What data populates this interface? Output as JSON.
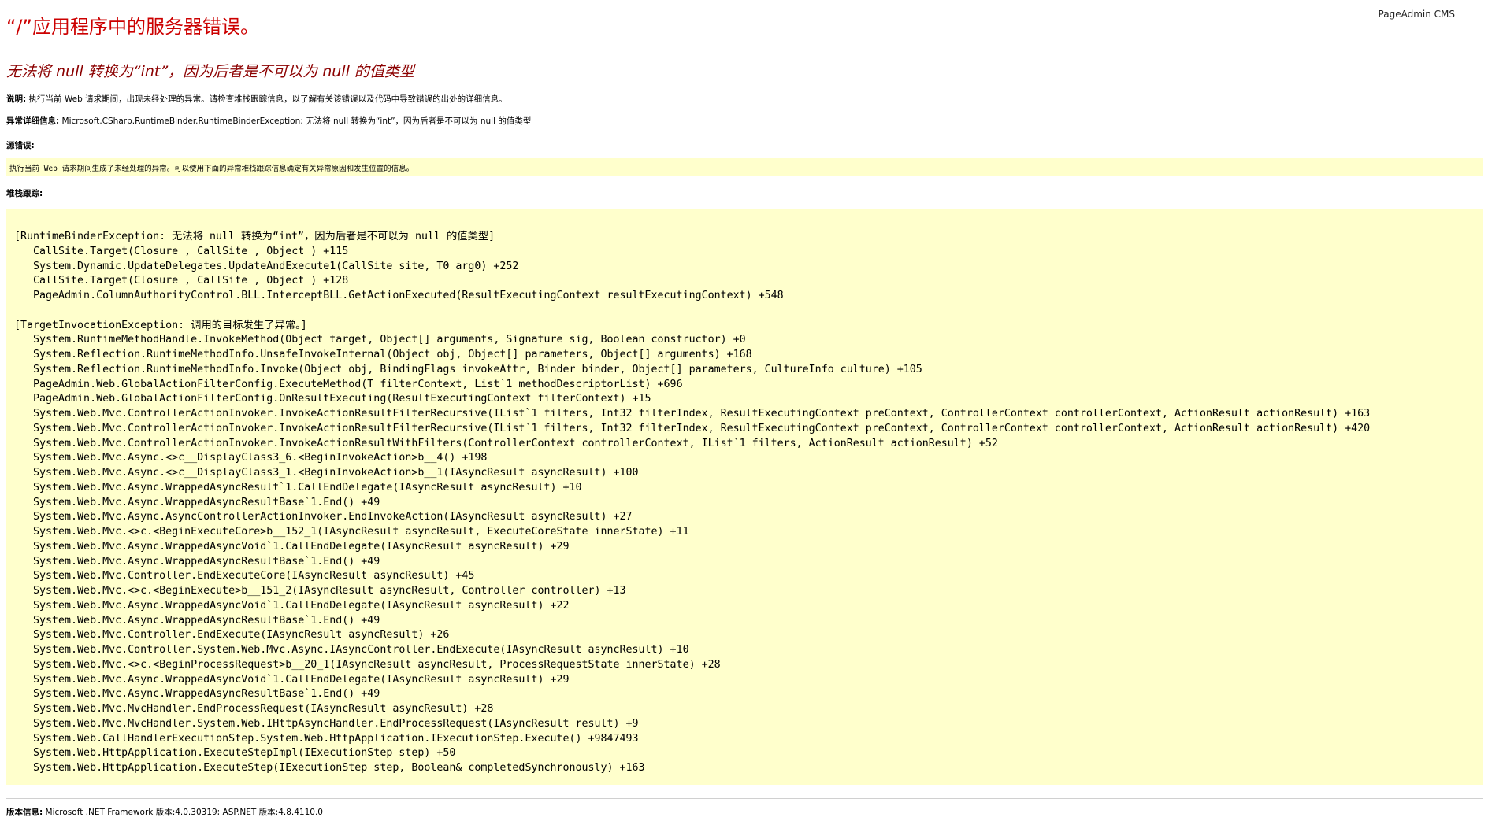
{
  "brand": "PageAdmin CMS",
  "title": "“/”应用程序中的服务器错误。",
  "subtitle": "无法将 null 转换为“int”，因为后者是不可以为 null 的值类型",
  "description": {
    "label": "说明:",
    "text": " 执行当前 Web 请求期间，出现未经处理的异常。请检查堆栈跟踪信息，以了解有关该错误以及代码中导致错误的出处的详细信息。"
  },
  "exception_details": {
    "label": "异常详细信息:",
    "text": " Microsoft.CSharp.RuntimeBinder.RuntimeBinderException: 无法将 null 转换为“int”，因为后者是不可以为 null 的值类型"
  },
  "source_error": {
    "label": "源错误:",
    "text": "执行当前 Web 请求期间生成了未经处理的异常。可以使用下面的异常堆栈跟踪信息确定有关异常原因和发生位置的信息。"
  },
  "stack_trace": {
    "label": "堆栈跟踪:",
    "text": "[RuntimeBinderException: 无法将 null 转换为“int”，因为后者是不可以为 null 的值类型]\n   CallSite.Target(Closure , CallSite , Object ) +115\n   System.Dynamic.UpdateDelegates.UpdateAndExecute1(CallSite site, T0 arg0) +252\n   CallSite.Target(Closure , CallSite , Object ) +128\n   PageAdmin.ColumnAuthorityControl.BLL.InterceptBLL.GetActionExecuted(ResultExecutingContext resultExecutingContext) +548\n\n[TargetInvocationException: 调用的目标发生了异常。]\n   System.RuntimeMethodHandle.InvokeMethod(Object target, Object[] arguments, Signature sig, Boolean constructor) +0\n   System.Reflection.RuntimeMethodInfo.UnsafeInvokeInternal(Object obj, Object[] parameters, Object[] arguments) +168\n   System.Reflection.RuntimeMethodInfo.Invoke(Object obj, BindingFlags invokeAttr, Binder binder, Object[] parameters, CultureInfo culture) +105\n   PageAdmin.Web.GlobalActionFilterConfig.ExecuteMethod(T filterContext, List`1 methodDescriptorList) +696\n   PageAdmin.Web.GlobalActionFilterConfig.OnResultExecuting(ResultExecutingContext filterContext) +15\n   System.Web.Mvc.ControllerActionInvoker.InvokeActionResultFilterRecursive(IList`1 filters, Int32 filterIndex, ResultExecutingContext preContext, ControllerContext controllerContext, ActionResult actionResult) +163\n   System.Web.Mvc.ControllerActionInvoker.InvokeActionResultFilterRecursive(IList`1 filters, Int32 filterIndex, ResultExecutingContext preContext, ControllerContext controllerContext, ActionResult actionResult) +420\n   System.Web.Mvc.ControllerActionInvoker.InvokeActionResultWithFilters(ControllerContext controllerContext, IList`1 filters, ActionResult actionResult) +52\n   System.Web.Mvc.Async.<>c__DisplayClass3_6.<BeginInvokeAction>b__4() +198\n   System.Web.Mvc.Async.<>c__DisplayClass3_1.<BeginInvokeAction>b__1(IAsyncResult asyncResult) +100\n   System.Web.Mvc.Async.WrappedAsyncResult`1.CallEndDelegate(IAsyncResult asyncResult) +10\n   System.Web.Mvc.Async.WrappedAsyncResultBase`1.End() +49\n   System.Web.Mvc.Async.AsyncControllerActionInvoker.EndInvokeAction(IAsyncResult asyncResult) +27\n   System.Web.Mvc.<>c.<BeginExecuteCore>b__152_1(IAsyncResult asyncResult, ExecuteCoreState innerState) +11\n   System.Web.Mvc.Async.WrappedAsyncVoid`1.CallEndDelegate(IAsyncResult asyncResult) +29\n   System.Web.Mvc.Async.WrappedAsyncResultBase`1.End() +49\n   System.Web.Mvc.Controller.EndExecuteCore(IAsyncResult asyncResult) +45\n   System.Web.Mvc.<>c.<BeginExecute>b__151_2(IAsyncResult asyncResult, Controller controller) +13\n   System.Web.Mvc.Async.WrappedAsyncVoid`1.CallEndDelegate(IAsyncResult asyncResult) +22\n   System.Web.Mvc.Async.WrappedAsyncResultBase`1.End() +49\n   System.Web.Mvc.Controller.EndExecute(IAsyncResult asyncResult) +26\n   System.Web.Mvc.Controller.System.Web.Mvc.Async.IAsyncController.EndExecute(IAsyncResult asyncResult) +10\n   System.Web.Mvc.<>c.<BeginProcessRequest>b__20_1(IAsyncResult asyncResult, ProcessRequestState innerState) +28\n   System.Web.Mvc.Async.WrappedAsyncVoid`1.CallEndDelegate(IAsyncResult asyncResult) +29\n   System.Web.Mvc.Async.WrappedAsyncResultBase`1.End() +49\n   System.Web.Mvc.MvcHandler.EndProcessRequest(IAsyncResult asyncResult) +28\n   System.Web.Mvc.MvcHandler.System.Web.IHttpAsyncHandler.EndProcessRequest(IAsyncResult result) +9\n   System.Web.CallHandlerExecutionStep.System.Web.HttpApplication.IExecutionStep.Execute() +9847493\n   System.Web.HttpApplication.ExecuteStepImpl(IExecutionStep step) +50\n   System.Web.HttpApplication.ExecuteStep(IExecutionStep step, Boolean& completedSynchronously) +163"
  },
  "version_info": {
    "label": "版本信息:",
    "text": " Microsoft .NET Framework 版本:4.0.30319; ASP.NET 版本:4.8.4110.0"
  },
  "colors": {
    "title": "#cc0000",
    "subtitle": "#8b0000",
    "code_background": "#ffffcc"
  }
}
